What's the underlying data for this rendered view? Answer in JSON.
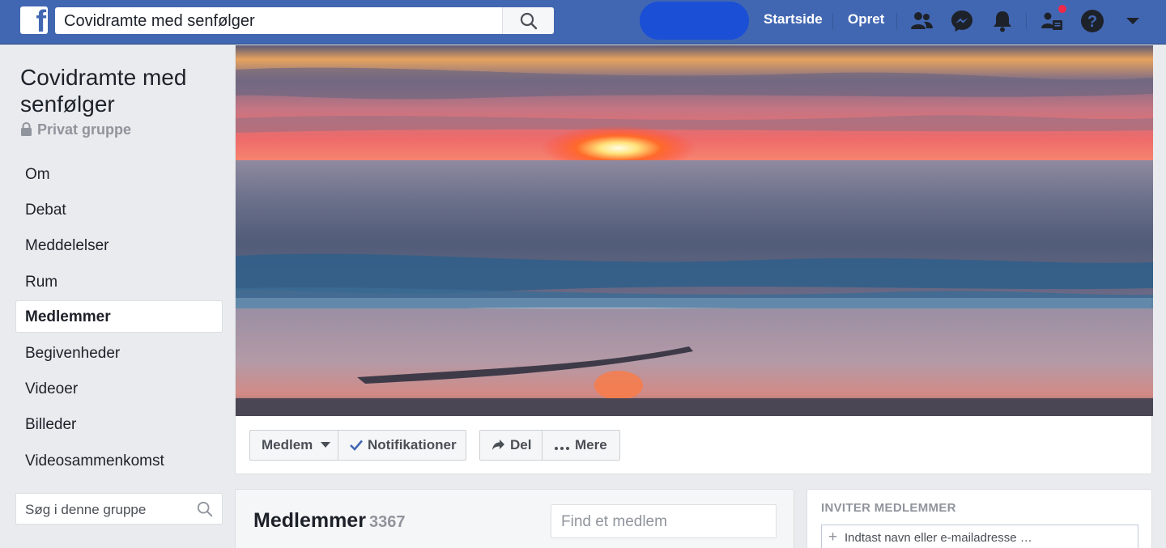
{
  "topbar": {
    "logo_icon": "facebook-f-icon",
    "search_value": "Covidramte med senfølger",
    "search_icon": "search-icon",
    "nav_home": "Startside",
    "nav_create": "Opret",
    "icons": [
      "friends-icon",
      "messenger-icon",
      "notifications-icon",
      "group-requests-icon",
      "help-icon",
      "chevron-down-icon"
    ],
    "brand_color": "#4267b2"
  },
  "group": {
    "title": "Covidramte med senfølger",
    "privacy": "Privat gruppe",
    "privacy_icon": "lock-icon"
  },
  "sidebar": {
    "items": [
      {
        "label": "Om",
        "active": false
      },
      {
        "label": "Debat",
        "active": false
      },
      {
        "label": "Meddelelser",
        "active": false
      },
      {
        "label": "Rum",
        "active": false
      },
      {
        "label": "Medlemmer",
        "active": true
      },
      {
        "label": "Begivenheder",
        "active": false
      },
      {
        "label": "Videoer",
        "active": false
      },
      {
        "label": "Billeder",
        "active": false
      },
      {
        "label": "Videosammenkomst",
        "active": false
      }
    ],
    "search_placeholder": "Søg i denne gruppe"
  },
  "cover": {
    "image": "sunset-over-sea-beach-photo"
  },
  "actions": {
    "member": "Medlem",
    "notifications": "Notifikationer",
    "share": "Del",
    "more": "Mere"
  },
  "members": {
    "title": "Medlemmer",
    "count": "3367",
    "find_placeholder": "Find et medlem"
  },
  "invite": {
    "title": "INVITER MEDLEMMER",
    "placeholder": "Indtast navn eller e-mailadresse …"
  }
}
